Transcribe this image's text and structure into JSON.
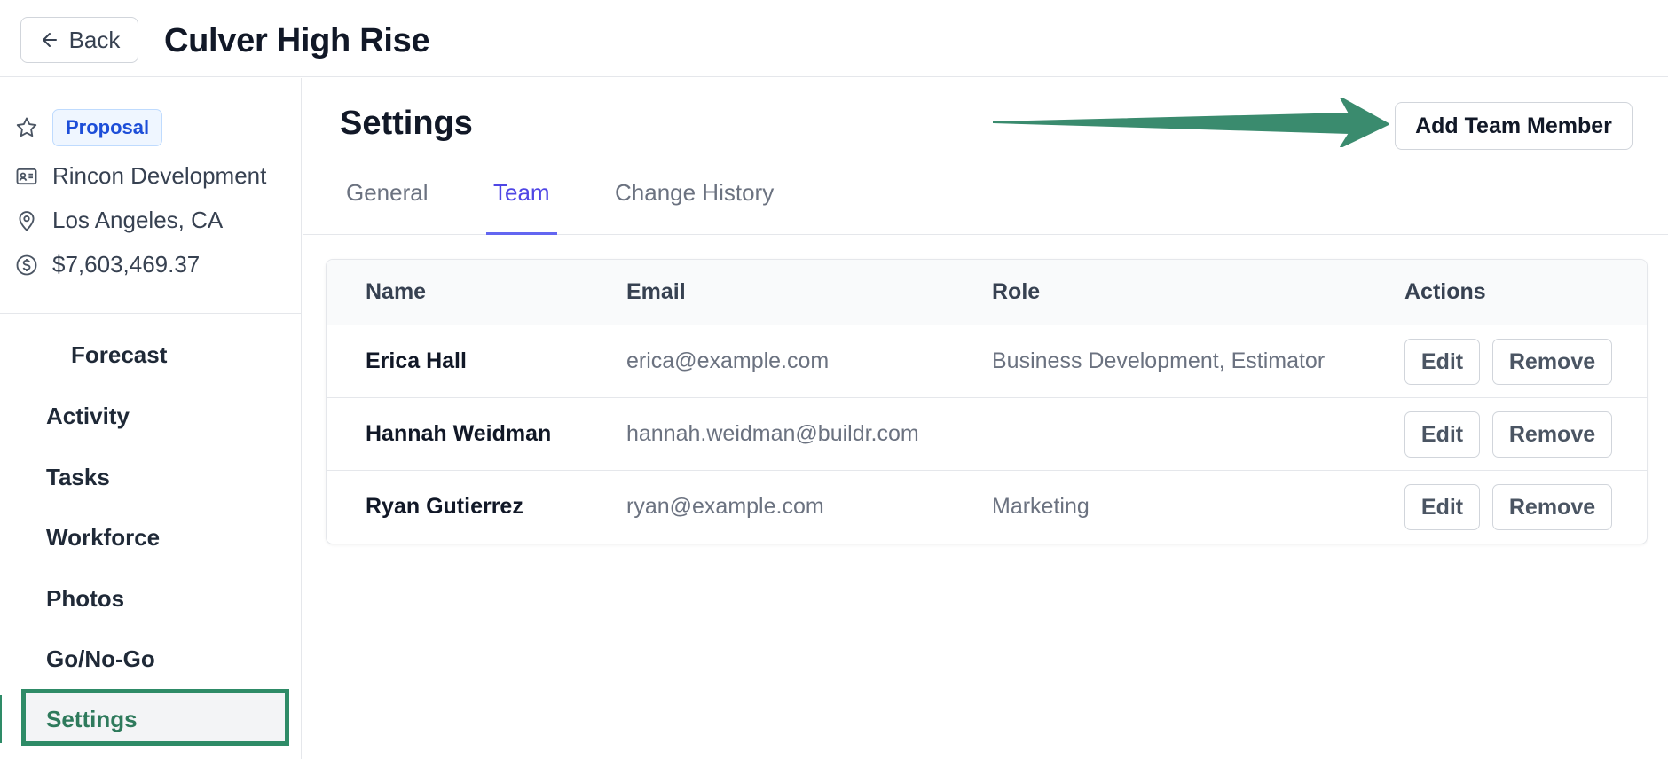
{
  "header": {
    "back_label": "Back",
    "project_title": "Culver High Rise"
  },
  "sidebar": {
    "status_badge": "Proposal",
    "company": "Rincon Development",
    "location": "Los Angeles, CA",
    "amount": "$7,603,469.37",
    "nav": [
      {
        "label": "Forecast"
      },
      {
        "label": "Activity"
      },
      {
        "label": "Tasks"
      },
      {
        "label": "Workforce"
      },
      {
        "label": "Photos"
      },
      {
        "label": "Go/No-Go"
      },
      {
        "label": "Settings",
        "active": true
      }
    ]
  },
  "main": {
    "title": "Settings",
    "add_button_label": "Add Team Member",
    "tabs": [
      {
        "label": "General"
      },
      {
        "label": "Team",
        "active": true
      },
      {
        "label": "Change History"
      }
    ],
    "table": {
      "columns": [
        "Name",
        "Email",
        "Role",
        "Actions"
      ],
      "rows": [
        {
          "name": "Erica Hall",
          "email": "erica@example.com",
          "role": "Business Development, Estimator"
        },
        {
          "name": "Hannah Weidman",
          "email": "hannah.weidman@buildr.com",
          "role": ""
        },
        {
          "name": "Ryan Gutierrez",
          "email": "ryan@example.com",
          "role": "Marketing"
        }
      ],
      "edit_label": "Edit",
      "remove_label": "Remove"
    }
  },
  "colors": {
    "accent": "#4f46e5",
    "highlight": "#2e8b67",
    "badge_bg": "#eff6ff",
    "badge_text": "#1d4ed8"
  },
  "icons": [
    "arrow-left-icon",
    "star-icon",
    "id-card-icon",
    "map-pin-icon",
    "dollar-circle-icon",
    "annotation-arrow"
  ]
}
